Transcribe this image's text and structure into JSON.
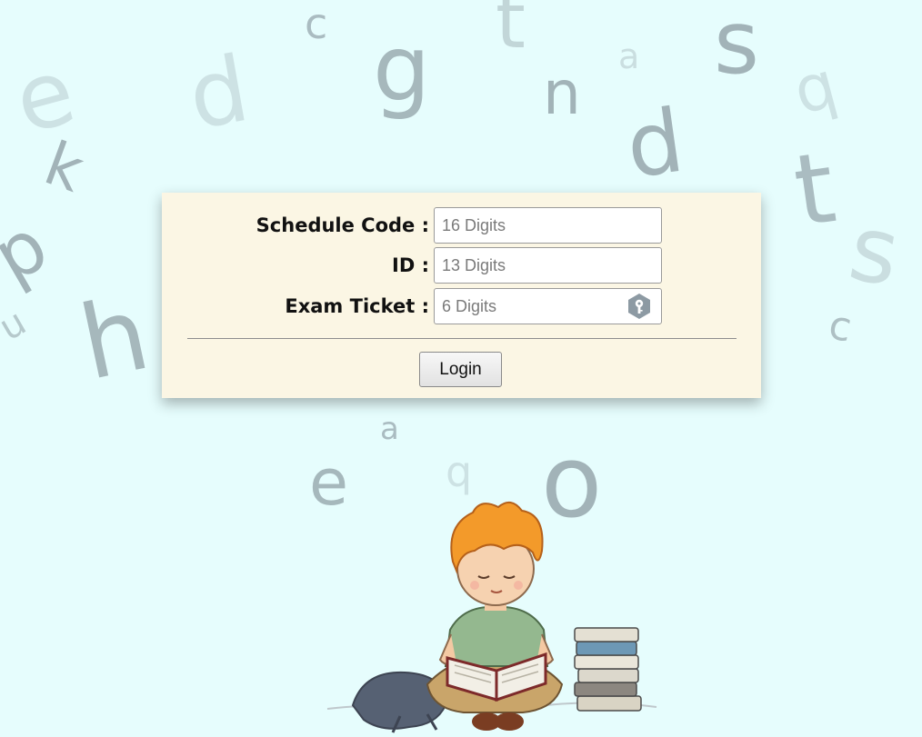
{
  "form": {
    "schedule_code": {
      "label": "Schedule Code :",
      "placeholder": "16 Digits",
      "value": ""
    },
    "id": {
      "label": "ID :",
      "placeholder": "13 Digits",
      "value": ""
    },
    "exam_ticket": {
      "label": "Exam Ticket :",
      "placeholder": "6 Digits",
      "value": "",
      "icon": "key-icon"
    },
    "login_label": "Login"
  },
  "background": {
    "letters": [
      "c",
      "t",
      "a",
      "s",
      "e",
      "d",
      "g",
      "n",
      "q",
      "k",
      "d",
      "t",
      "p",
      "u",
      "s",
      "c",
      "h",
      "a",
      "e",
      "q",
      "o"
    ]
  },
  "colors": {
    "page_background": "#e6fdfd",
    "card_background": "#fbf6e4",
    "letter_color": "#97a7ad",
    "key_icon_color": "#8d9aa3"
  },
  "illustration": {
    "icon": "boy-reading-book-illustration"
  }
}
